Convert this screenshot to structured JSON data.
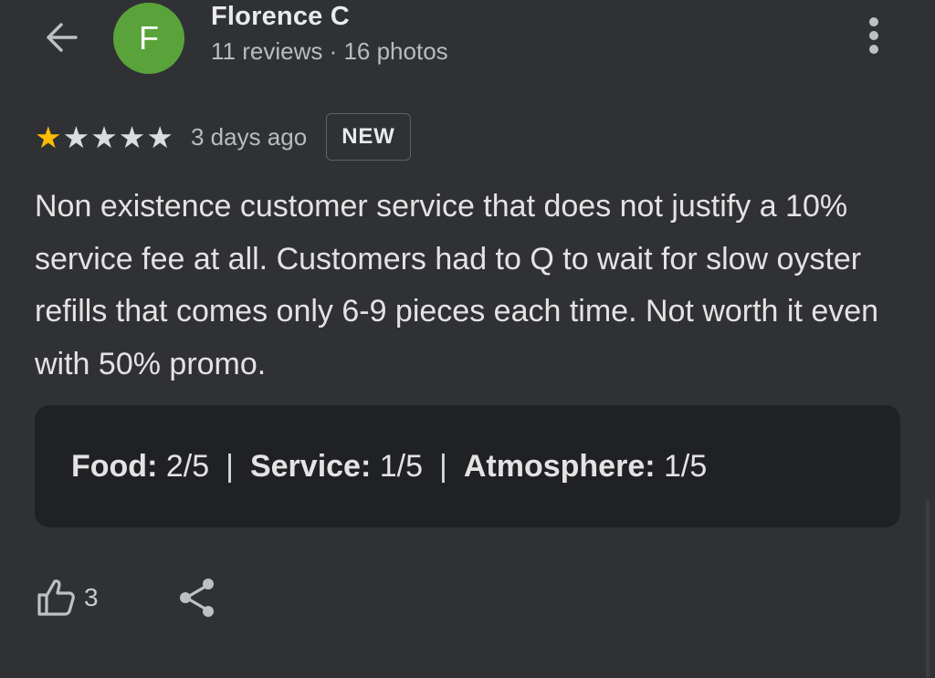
{
  "header": {
    "avatar_letter": "F",
    "avatar_color": "#5aa33a",
    "name": "Florence C",
    "meta": "11 reviews · 16 photos",
    "back_icon": "arrow-left-icon",
    "more_icon": "more-vert-icon"
  },
  "review": {
    "rating": 1,
    "max_rating": 5,
    "star_filled_color": "#fbbc04",
    "star_empty_color": "#dadce0",
    "date": "3 days ago",
    "badge": "NEW",
    "text": "Non existence customer service that does not justify a 10% service fee at all. Customers had to Q to wait for slow oyster refills that comes only 6-9 pieces each time. Not worth it even with 50% promo."
  },
  "sub_ratings": [
    {
      "label": "Food:",
      "value": "2/5"
    },
    {
      "label": "Service:",
      "value": "1/5"
    },
    {
      "label": "Atmosphere:",
      "value": "1/5"
    }
  ],
  "actions": {
    "like_icon": "thumbs-up-icon",
    "like_count": "3",
    "share_icon": "share-icon"
  }
}
